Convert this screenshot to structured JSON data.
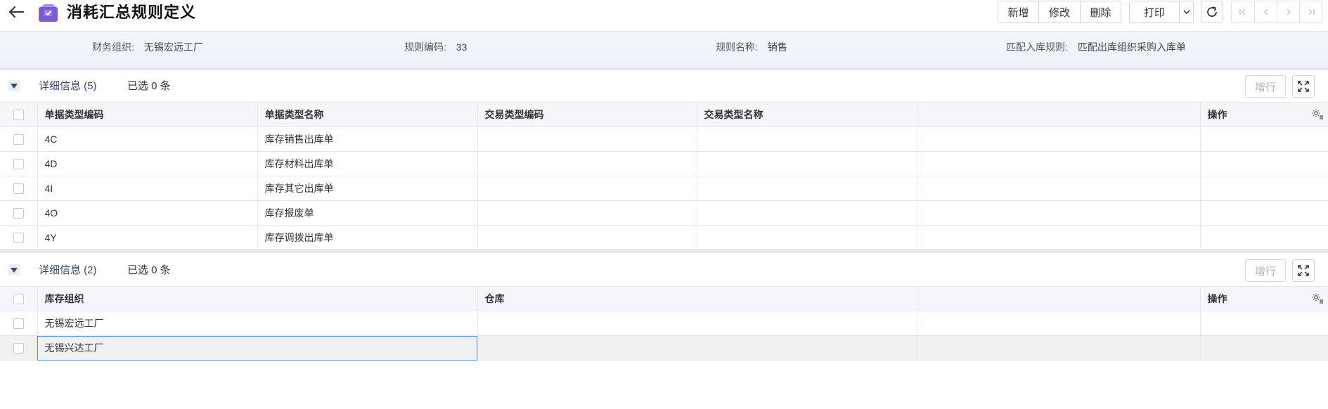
{
  "header": {
    "title": "消耗汇总规则定义",
    "buttons": {
      "add": "新增",
      "edit": "修改",
      "delete": "删除",
      "print": "打印"
    }
  },
  "info": {
    "org_label": "财务组织:",
    "org_value": "无锡宏远工厂",
    "code_label": "规则编码:",
    "code_value": "33",
    "name_label": "规则名称:",
    "name_value": "销售",
    "match_label": "匹配入库规则:",
    "match_value": "匹配出库组织采购入库单"
  },
  "section1": {
    "title": "详细信息 (5)",
    "selected": "已选 0 条",
    "add_row": "增行",
    "columns": [
      "单据类型编码",
      "单据类型名称",
      "交易类型编码",
      "交易类型名称",
      "",
      "操作"
    ],
    "rows": [
      {
        "code": "4C",
        "name": "库存销售出库单"
      },
      {
        "code": "4D",
        "name": "库存材料出库单"
      },
      {
        "code": "4I",
        "name": "库存其它出库单"
      },
      {
        "code": "4O",
        "name": "库存报废单"
      },
      {
        "code": "4Y",
        "name": "库存调拨出库单"
      }
    ]
  },
  "section2": {
    "title": "详细信息 (2)",
    "selected": "已选 0 条",
    "add_row": "增行",
    "columns": [
      "库存组织",
      "仓库",
      "",
      "操作"
    ],
    "rows": [
      {
        "org": "无锡宏远工厂"
      },
      {
        "org": "无锡兴达工厂"
      }
    ]
  },
  "colors": {
    "accent": "#4a8ce0",
    "icon_purple": "#7b5bd6"
  }
}
